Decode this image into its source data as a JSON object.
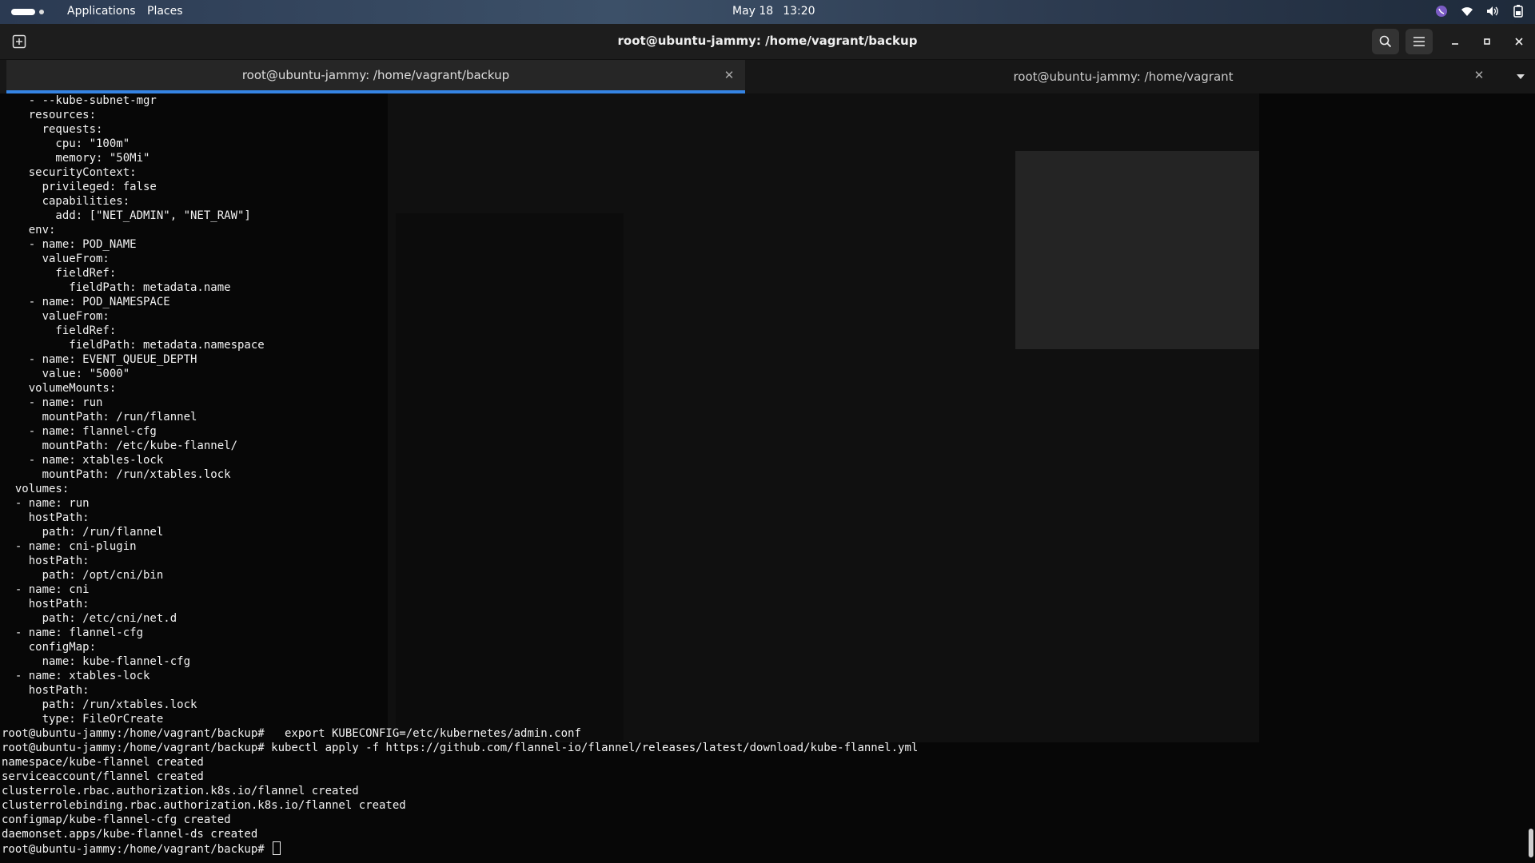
{
  "topbar": {
    "applications": "Applications",
    "places": "Places",
    "date": "May 18",
    "time": "13:20"
  },
  "window": {
    "title": "root@ubuntu-jammy: /home/vagrant/backup"
  },
  "tabs": [
    {
      "label": "root@ubuntu-jammy: /home/vagrant/backup",
      "active": true
    },
    {
      "label": "root@ubuntu-jammy: /home/vagrant",
      "active": false
    }
  ],
  "colors": {
    "accent": "#3584e4",
    "terminal_bg": "#070707",
    "header_bg": "#1d1d1d"
  },
  "terminal": {
    "lines": [
      "    - --kube-subnet-mgr",
      "    resources:",
      "      requests:",
      "        cpu: \"100m\"",
      "        memory: \"50Mi\"",
      "    securityContext:",
      "      privileged: false",
      "      capabilities:",
      "        add: [\"NET_ADMIN\", \"NET_RAW\"]",
      "    env:",
      "    - name: POD_NAME",
      "      valueFrom:",
      "        fieldRef:",
      "          fieldPath: metadata.name",
      "    - name: POD_NAMESPACE",
      "      valueFrom:",
      "        fieldRef:",
      "          fieldPath: metadata.namespace",
      "    - name: EVENT_QUEUE_DEPTH",
      "      value: \"5000\"",
      "    volumeMounts:",
      "    - name: run",
      "      mountPath: /run/flannel",
      "    - name: flannel-cfg",
      "      mountPath: /etc/kube-flannel/",
      "    - name: xtables-lock",
      "      mountPath: /run/xtables.lock",
      "  volumes:",
      "  - name: run",
      "    hostPath:",
      "      path: /run/flannel",
      "  - name: cni-plugin",
      "    hostPath:",
      "      path: /opt/cni/bin",
      "  - name: cni",
      "    hostPath:",
      "      path: /etc/cni/net.d",
      "  - name: flannel-cfg",
      "    configMap:",
      "      name: kube-flannel-cfg",
      "  - name: xtables-lock",
      "    hostPath:",
      "      path: /run/xtables.lock",
      "      type: FileOrCreate",
      "root@ubuntu-jammy:/home/vagrant/backup#   export KUBECONFIG=/etc/kubernetes/admin.conf",
      "root@ubuntu-jammy:/home/vagrant/backup# kubectl apply -f https://github.com/flannel-io/flannel/releases/latest/download/kube-flannel.yml",
      "namespace/kube-flannel created",
      "serviceaccount/flannel created",
      "clusterrole.rbac.authorization.k8s.io/flannel created",
      "clusterrolebinding.rbac.authorization.k8s.io/flannel created",
      "configmap/kube-flannel-cfg created",
      "daemonset.apps/kube-flannel-ds created"
    ],
    "prompt": "root@ubuntu-jammy:/home/vagrant/backup# "
  }
}
